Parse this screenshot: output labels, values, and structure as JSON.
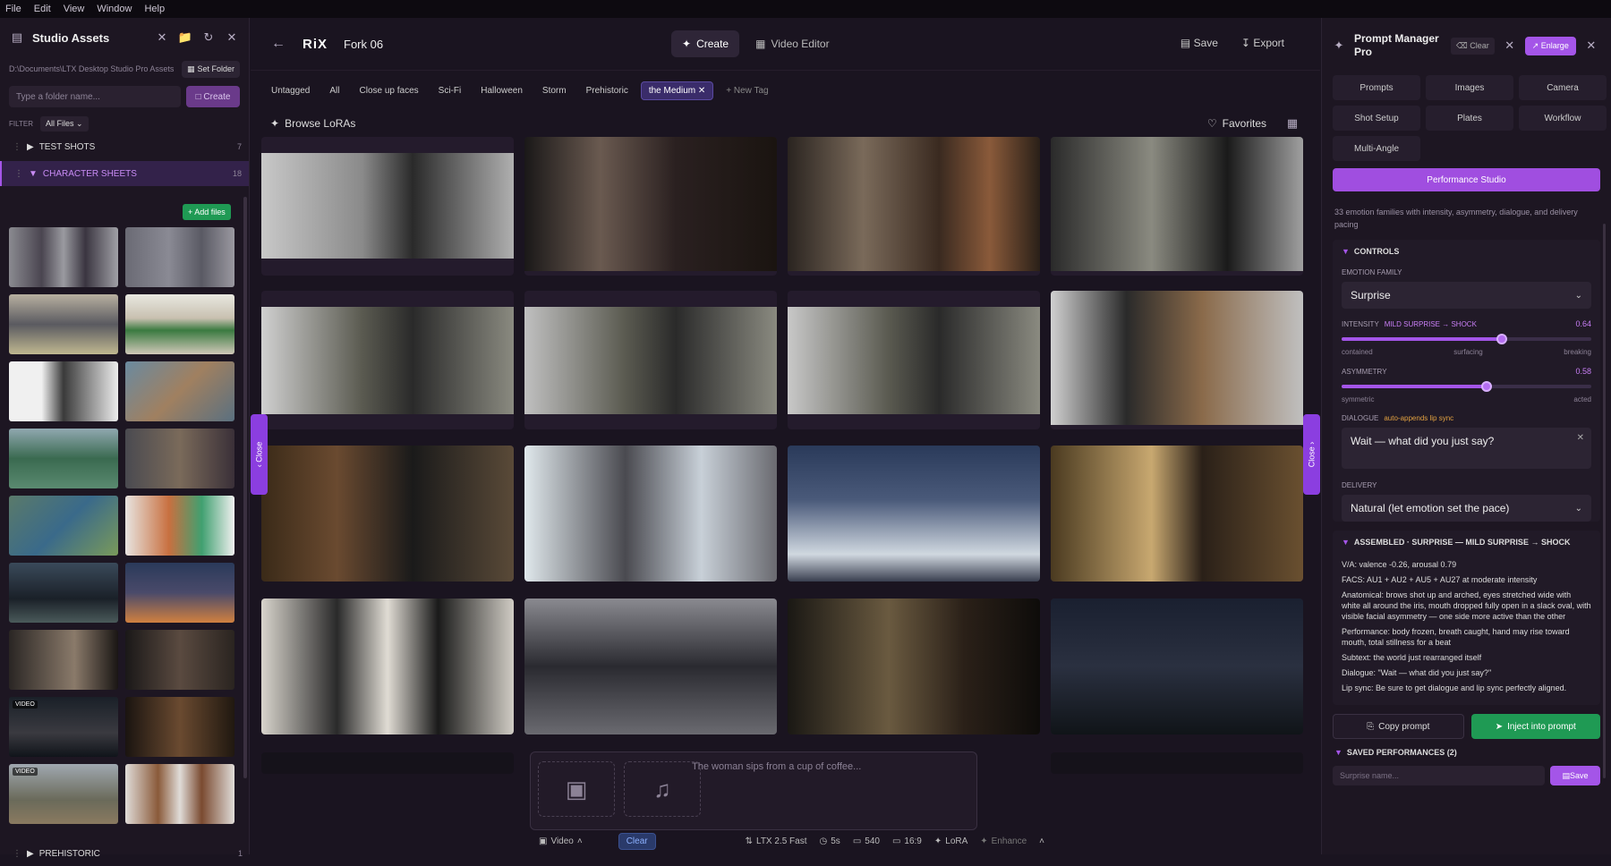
{
  "menu": [
    "File",
    "Edit",
    "View",
    "Window",
    "Help"
  ],
  "left": {
    "title": "Studio Assets",
    "path": "D:\\Documents\\LTX Desktop Studio Pro Assets",
    "set_folder": "Set Folder",
    "folder_placeholder": "Type a folder name...",
    "create": "Create",
    "filter_label": "FILTER",
    "filter_value": "All Files",
    "folders": [
      {
        "name": "TEST SHOTS",
        "count": "7"
      },
      {
        "name": "CHARACTER SHEETS",
        "count": "18"
      }
    ],
    "add_files": "Add files",
    "video_badge": "VIDEO",
    "prehistoric": {
      "name": "PREHISTORIC",
      "count": "1"
    }
  },
  "center": {
    "logo": "RiX",
    "project": "Fork 06",
    "modes": [
      "Create",
      "Video Editor"
    ],
    "save": "Save",
    "export": "Export",
    "tags": [
      "Untagged",
      "All",
      "Close up faces",
      "Sci-Fi",
      "Halloween",
      "Storm",
      "Prehistoric"
    ],
    "active_tag": "the Medium",
    "new_tag": "+ New Tag",
    "browse_loras": "Browse LoRAs",
    "favorites": "Favorites",
    "close": "Close",
    "prompt_placeholder": "The woman sips from a cup of coffee...",
    "bottom": {
      "video": "Video",
      "clear": "Clear",
      "model": "LTX 2.5 Fast",
      "duration": "5s",
      "resolution": "540",
      "aspect": "16:9",
      "lora": "LoRA",
      "enhance": "Enhance"
    }
  },
  "right": {
    "title": "Prompt Manager Pro",
    "clear": "Clear",
    "enlarge": "Enlarge",
    "tabs": [
      "Prompts",
      "Images",
      "Camera",
      "Shot Setup",
      "Plates",
      "Workflow",
      "Multi-Angle"
    ],
    "performance_studio": "Performance Studio",
    "description": "33 emotion families with intensity, asymmetry, dialogue, and delivery pacing",
    "controls": "CONTROLS",
    "emotion_family_label": "EMOTION FAMILY",
    "emotion_family": "Surprise",
    "intensity_label": "INTENSITY",
    "intensity_range": "MILD SURPRISE → SHOCK",
    "intensity_value": "0.64",
    "intensity_scale": [
      "contained",
      "surfacing",
      "breaking"
    ],
    "asymmetry_label": "ASYMMETRY",
    "asymmetry_value": "0.58",
    "asymmetry_scale": [
      "symmetric",
      "acted"
    ],
    "dialogue_label": "DIALOGUE",
    "dialogue_note": "auto-appends lip sync",
    "dialogue": "Wait — what did you just say?",
    "delivery_label": "DELIVERY",
    "delivery": "Natural (let emotion set the pace)",
    "assembled_title": "ASSEMBLED · SURPRISE — MILD SURPRISE → SHOCK",
    "assembled": [
      "V/A: valence -0.26, arousal 0.79",
      "FACS: AU1 + AU2 + AU5 + AU27 at moderate intensity",
      "Anatomical: brows shot up and arched, eyes stretched wide with white all around the iris, mouth dropped fully open in a slack oval, with visible facial asymmetry — one side more active than the other",
      "Performance: body frozen, breath caught, hand may rise toward mouth, total stillness for a beat",
      "Subtext: the world just rearranged itself",
      "Dialogue: \"Wait — what did you just say?\"",
      "Lip sync: Be sure to get dialogue and lip sync perfectly aligned."
    ],
    "copy_prompt": "Copy prompt",
    "inject": "Inject into prompt",
    "saved_title": "SAVED PERFORMANCES (2)",
    "saved_placeholder": "Surprise name...",
    "save": "Save"
  },
  "colors": {
    "accent": "#a455e8",
    "green": "#1f9a54",
    "bg": "#1a1420"
  }
}
